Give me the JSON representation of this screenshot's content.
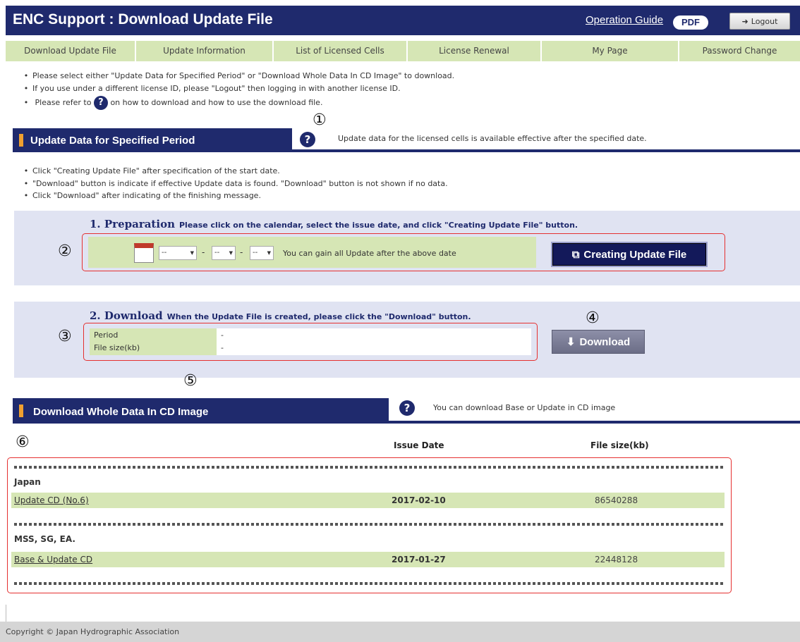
{
  "header": {
    "title": "ENC Support : Download Update File",
    "operation_guide": "Operation Guide",
    "pdf_badge": "PDF",
    "logout_icon": "logout-icon",
    "logout_label": "Logout",
    "background": "#1f2a6d"
  },
  "nav": {
    "items": [
      {
        "label": "Download Update File"
      },
      {
        "label": "Update Information"
      },
      {
        "label": "List of Licensed Cells"
      },
      {
        "label": "License Renewal"
      },
      {
        "label": "My Page"
      },
      {
        "label": "Password Change"
      }
    ]
  },
  "intro": {
    "line1": "Please select either \"Update Data for Specified Period\" or \"Download Whole Data In CD Image\" to download.",
    "line2": "If you use under a different license ID, please \"Logout\" then logging in with another license ID.",
    "line3_pre": "Please refer to",
    "line3_post": "on how to download and how to use the download file."
  },
  "section_update": {
    "title": "Update Data for Specified Period",
    "note": "Update data for the licensed cells is available effective after the specified date.",
    "bullets": [
      "Click \"Creating Update File\" after specification of the start date.",
      "\"Download\" button is indicate if effective Update data is found. \"Download\" button is not shown if no data.",
      "Click \"Download\" after indicating of the finishing message."
    ]
  },
  "preparation": {
    "heading": "1. Preparation",
    "instruction": "Please click on the calendar, select the issue date, and click \"Creating Update File\" button.",
    "calendar_icon": "calendar-icon",
    "year_value": "--",
    "month_value": "--",
    "day_value": "--",
    "separator": "-",
    "hint": "You can gain all Update after the above date",
    "create_button": "Creating Update File"
  },
  "download": {
    "heading": "2. Download",
    "instruction": "When the Update File is created, please click the \"Download\" button.",
    "period_label": "Period",
    "period_value": "-",
    "size_label": "File size(kb)",
    "size_value": "-",
    "button": "Download"
  },
  "section_cd": {
    "title": "Download Whole Data In CD Image",
    "note": "You can download Base or Update in CD image",
    "col_issue": "Issue Date",
    "col_size": "File size(kb)",
    "groups": [
      {
        "name": "Japan",
        "link": "Update CD (No.6)",
        "issue_date": "2017-02-10",
        "file_size": "86540288"
      },
      {
        "name": "MSS, SG, EA.",
        "link": "Base & Update CD",
        "issue_date": "2017-01-27",
        "file_size": "22448128"
      }
    ]
  },
  "annotations": [
    "①",
    "②",
    "③",
    "④",
    "⑤",
    "⑥"
  ],
  "footer": {
    "text": "Copyright © Japan Hydrographic Association"
  }
}
